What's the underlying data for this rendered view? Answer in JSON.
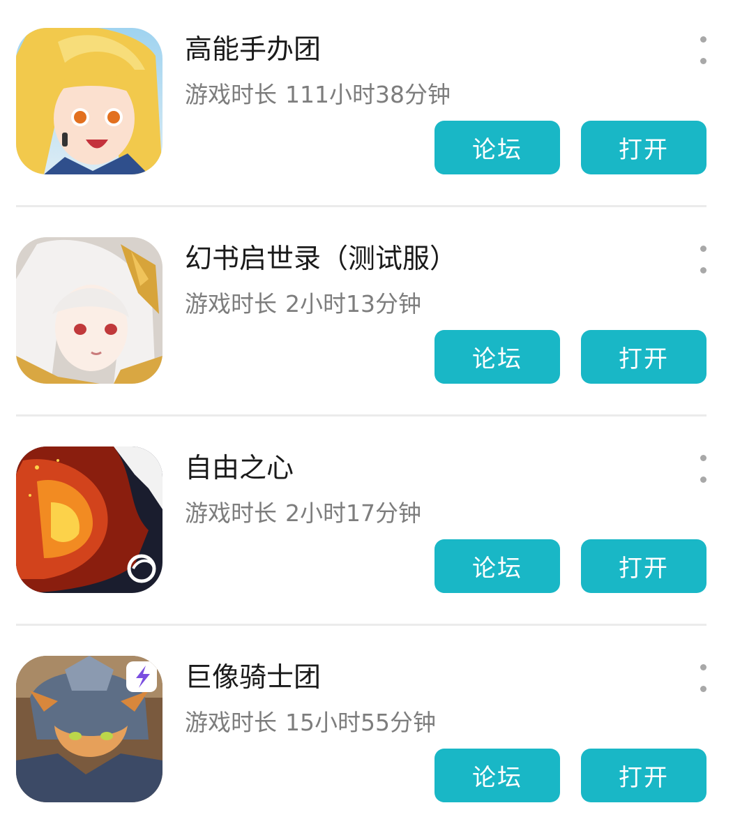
{
  "games": [
    {
      "title": "高能手办团",
      "playtime_label": "游戏时长",
      "playtime_value": "111小时38分钟",
      "forum_label": "论坛",
      "open_label": "打开",
      "icon": "anime-girl-blonde-icon"
    },
    {
      "title": "幻书启世录（测试服）",
      "playtime_label": "游戏时长",
      "playtime_value": "2小时13分钟",
      "forum_label": "论坛",
      "open_label": "打开",
      "icon": "anime-girl-silver-hair-icon"
    },
    {
      "title": "自由之心",
      "playtime_label": "游戏时长",
      "playtime_value": "2小时17分钟",
      "forum_label": "论坛",
      "open_label": "打开",
      "icon": "fire-beast-icon"
    },
    {
      "title": "巨像骑士团",
      "playtime_label": "游戏时长",
      "playtime_value": "15小时55分钟",
      "forum_label": "论坛",
      "open_label": "打开",
      "icon": "armored-fox-knight-icon"
    }
  ],
  "colors": {
    "button": "#19b7c6",
    "title": "#1a1a1a",
    "subtitle": "#7d7d7d",
    "divider": "#ebebeb"
  }
}
